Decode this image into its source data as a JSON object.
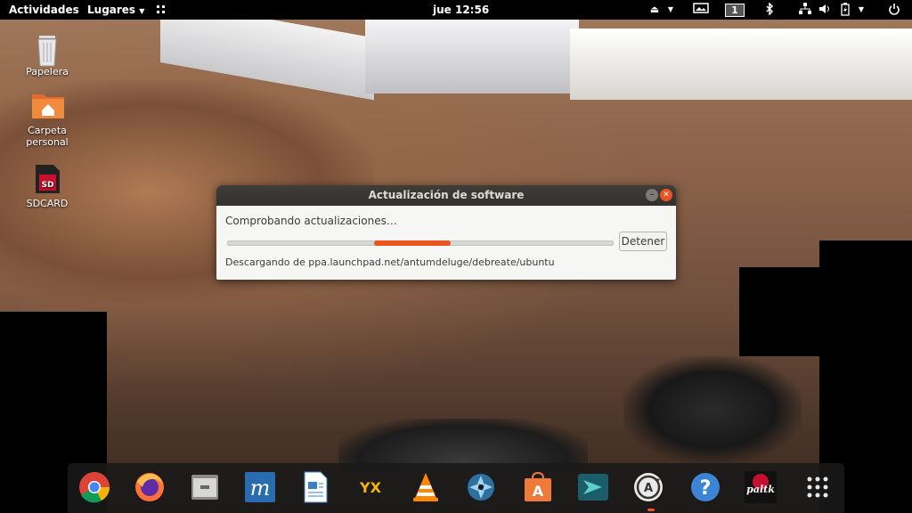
{
  "topbar": {
    "activities": "Actividades",
    "places": "Lugares",
    "clock": "jue 12:56",
    "workspace": "1"
  },
  "desktop": {
    "icons": [
      {
        "label": "Papelera"
      },
      {
        "label": "Carpeta personal"
      },
      {
        "label": "SDCARD"
      }
    ]
  },
  "dialog": {
    "title": "Actualización de software",
    "status": "Comprobando actualizaciones…",
    "stop_label": "Detener",
    "detail": "Descargando de ppa.launchpad.net/antumdeluge/debreate/ubuntu",
    "progress": 0.38,
    "close_color": "#e95420"
  },
  "dock": {
    "apps": [
      {
        "icon": "chrome-icon"
      },
      {
        "icon": "firefox-icon"
      },
      {
        "icon": "files-icon"
      },
      {
        "icon": "writer-m-icon"
      },
      {
        "icon": "libreoffice-writer-icon"
      },
      {
        "icon": "yx-app-icon"
      },
      {
        "icon": "vlc-icon"
      },
      {
        "icon": "shutter-icon"
      },
      {
        "icon": "software-center-icon"
      },
      {
        "icon": "arrow-app-icon"
      },
      {
        "icon": "software-updater-icon"
      },
      {
        "icon": "help-icon"
      },
      {
        "icon": "paltalk-icon"
      },
      {
        "icon": "show-apps-icon"
      }
    ],
    "logo_texts": {
      "paltalk": "paltk",
      "yx": "YX"
    }
  },
  "colors": {
    "accent": "#e95420",
    "topbar": "#000000",
    "dialog_title": "#3f3d39"
  }
}
